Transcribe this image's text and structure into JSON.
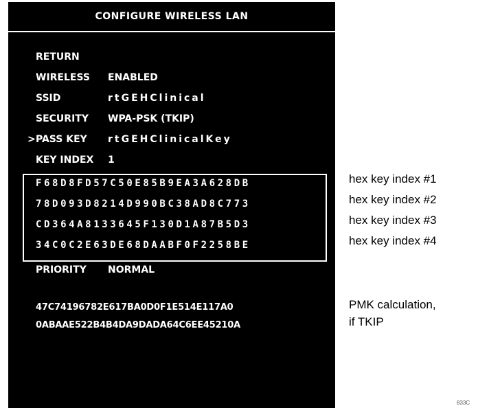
{
  "screen": {
    "title": "CONFIGURE WIRELESS LAN",
    "cursor": ">",
    "menu": [
      {
        "label": "RETURN",
        "value": ""
      },
      {
        "label": "WIRELESS",
        "value": "ENABLED"
      },
      {
        "label": "SSID",
        "value": "rtGEHClinical"
      },
      {
        "label": "SECURITY",
        "value": "WPA-PSK (TKIP)"
      },
      {
        "label": "PASS KEY",
        "value": "rtGEHClinicalKey"
      },
      {
        "label": "KEY INDEX",
        "value": "1"
      }
    ],
    "hex_keys": [
      "F68D8FD57C50E85B9EA3A628DB",
      "78D093D8214D990BC38AD8C773",
      "CD364A8133645F130D1A87B5D3",
      "34C0C2E63DE68DAABF0F2258BE"
    ],
    "priority": {
      "label": "PRIORITY",
      "value": "NORMAL"
    },
    "pmk": [
      "47C74196782E617BA0D0F1E514E117A0",
      "0ABAAE522B4B4DA9DADA64C6EE45210A"
    ]
  },
  "annotations": {
    "hex_labels": [
      "hex key index #1",
      "hex key index #2",
      "hex key index #3",
      "hex key index #4"
    ],
    "pmk_label_line1": "PMK calculation,",
    "pmk_label_line2": "if TKIP"
  },
  "figure_id": "833C"
}
